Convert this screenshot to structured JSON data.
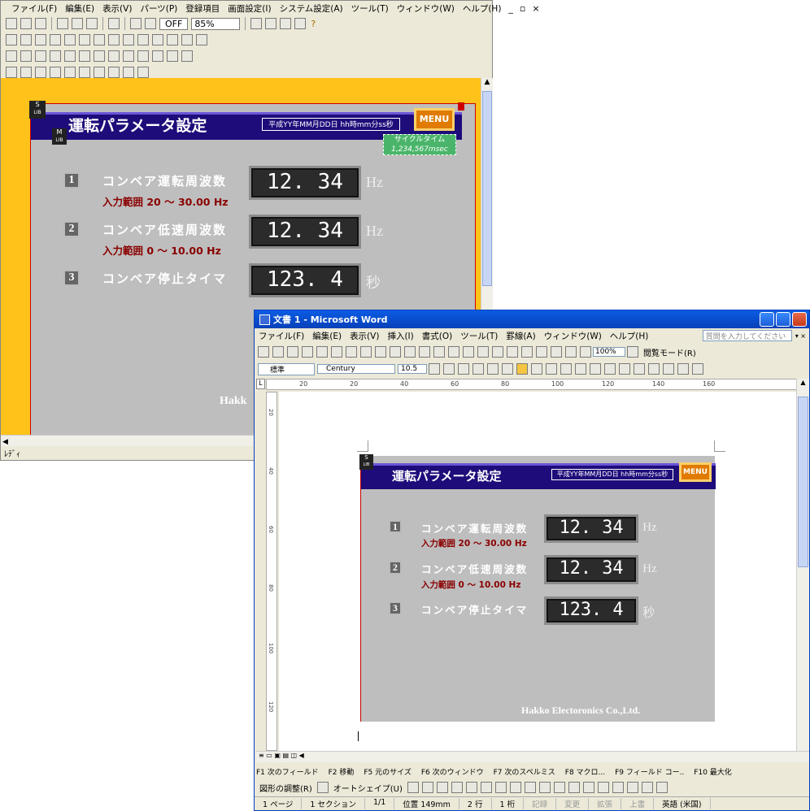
{
  "back": {
    "menu": [
      "ファイル(F)",
      "編集(E)",
      "表示(V)",
      "パーツ(P)",
      "登録項目",
      "画面設定(I)",
      "システム設定(A)",
      "ツール(T)",
      "ウィンドウ(W)",
      "ヘルプ(H)"
    ],
    "toolbar": {
      "off_label": "OFF",
      "zoom": "85%"
    },
    "status": "ﾚﾃﾞｨ"
  },
  "screen": {
    "slib_top": "S",
    "slib_bot": "LIB",
    "mlib_top": "M",
    "mlib_bot": "LIB",
    "title": "運転パラメータ設定",
    "datetime": "平成YY年MM月DD日 hh時mm分ss秒",
    "menu_btn": "MENU",
    "cycle_label": "サイクルタイム",
    "cycle_value": "1,234,567msec",
    "rows": [
      {
        "num": "1",
        "label": "コンベア運転周波数",
        "value": "12. 34",
        "unit": "Hz",
        "range": "入力範囲 20 ～ 30.00 Hz"
      },
      {
        "num": "2",
        "label": "コンベア低速周波数",
        "value": "12. 34",
        "unit": "Hz",
        "range": "入力範囲 0 ～ 10.00 Hz"
      },
      {
        "num": "3",
        "label": "コンベア停止タイマ",
        "value": "123. 4",
        "unit": "秒",
        "range": ""
      }
    ],
    "company_partial": "Hakk",
    "company": "Hakko Electoronics Co.,Ltd."
  },
  "word": {
    "title": "文書 1 - Microsoft Word",
    "menu": [
      "ファイル(F)",
      "編集(E)",
      "表示(V)",
      "挿入(I)",
      "書式(O)",
      "ツール(T)",
      "罫線(A)",
      "ウィンドウ(W)",
      "ヘルプ(H)"
    ],
    "help_placeholder": "質問を入力してください",
    "zoom": "100%",
    "reading_mode": "閲覧モード(R)",
    "style": "標準",
    "font": "Century",
    "size": "10.5",
    "ruler_marks": [
      "20",
      "20",
      "40",
      "60",
      "80",
      "100",
      "120",
      "140",
      "160"
    ],
    "vruler_marks": [
      "20",
      "40",
      "60",
      "80",
      "100",
      "120"
    ],
    "fkeys": [
      "F1 次のフィールド",
      "F2 移動",
      "F5 元のサイズ",
      "F6 次のウィンドウ",
      "F7 次のスペルミス",
      "F8 マクロ...",
      "F9 フィールド コー..",
      "F10 最大化"
    ],
    "drawbar": [
      "図形の調整(R)",
      "オートシェイプ(U)"
    ],
    "statusbar": [
      "1 ページ",
      "1 セクション",
      "1/1",
      "位置 149mm",
      "2 行",
      "1 桁",
      "記録",
      "変更",
      "拡張",
      "上書",
      "英語 (米国)"
    ]
  }
}
